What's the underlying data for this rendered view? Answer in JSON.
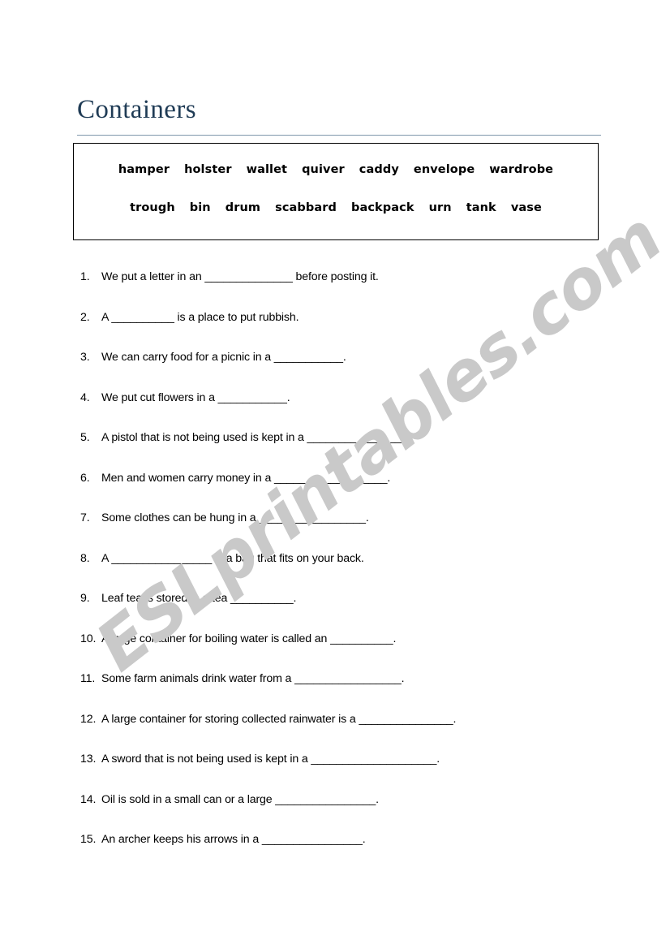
{
  "page": {
    "title": "Containers",
    "title_color": "#1f3b55",
    "rule_color": "#7f96ab",
    "background": "#ffffff",
    "text_color": "#000000"
  },
  "watermark": {
    "text": "ESLprintables.com",
    "color": "#c9c9c9",
    "rotation_deg": -38
  },
  "word_bank": {
    "border_color": "#000000",
    "row1": [
      "hamper",
      "holster",
      "wallet",
      "quiver",
      "caddy",
      "envelope",
      "wardrobe"
    ],
    "row2": [
      "trough",
      "bin",
      "drum",
      "scabbard",
      "backpack",
      "urn",
      "tank",
      "vase"
    ]
  },
  "questions": [
    {
      "number": "1.",
      "text": "We put a letter in an ______________ before posting it."
    },
    {
      "number": "2.",
      "text": "A __________ is a place to put rubbish."
    },
    {
      "number": "3.",
      "text": "We can carry food for a picnic in a ___________."
    },
    {
      "number": "4.",
      "text": "We put cut flowers in a ___________."
    },
    {
      "number": "5.",
      "text": "A pistol that is not being used is kept in a _______________."
    },
    {
      "number": "6.",
      "text": "Men and women carry money in a __________________."
    },
    {
      "number": "7.",
      "text": "Some clothes can be hung in a _________________."
    },
    {
      "number": "8.",
      "text": "A ________________ is a bag that fits on your back."
    },
    {
      "number": "9.",
      "text": "Leaf tea is stored in a tea __________."
    },
    {
      "number": "10.",
      "text": "A large container for boiling water is called an __________."
    },
    {
      "number": "11.",
      "text": "Some farm animals drink water from a _________________."
    },
    {
      "number": "12.",
      "text": "A large container for storing collected rainwater is a _______________."
    },
    {
      "number": "13.",
      "text": "A sword that is not being used is kept in a ____________________."
    },
    {
      "number": "14.",
      "text": "Oil is sold in a small can or a large ________________."
    },
    {
      "number": "15.",
      "text": "An archer keeps his arrows in a  ________________."
    }
  ]
}
